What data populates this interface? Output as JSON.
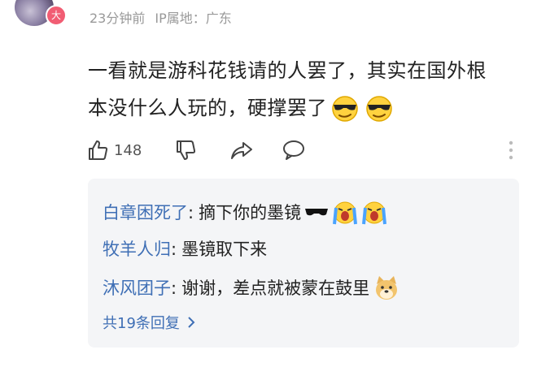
{
  "comment": {
    "avatar_badge": "大",
    "time": "23分钟前",
    "location_label": "IP属地：广东",
    "text_line1": "一看就是游科花钱请的人罢了，其实在国外根",
    "text_line2": "本没什么人玩的，硬撑罢了",
    "like_count": "148"
  },
  "replies": [
    {
      "name": "白章困死了",
      "colon": ":",
      "text": "摘下你的墨镜"
    },
    {
      "name": "牧羊人归",
      "colon": ":",
      "text": "墨镜取下来"
    },
    {
      "name": "沐风团子",
      "colon": ":",
      "text": "谢谢，差点就被蒙在鼓里"
    }
  ],
  "more_replies_label": "共19条回复",
  "colors": {
    "name_link": "#3f6fb5",
    "meta_gray": "#999999",
    "reply_bg": "#f4f5f7"
  }
}
